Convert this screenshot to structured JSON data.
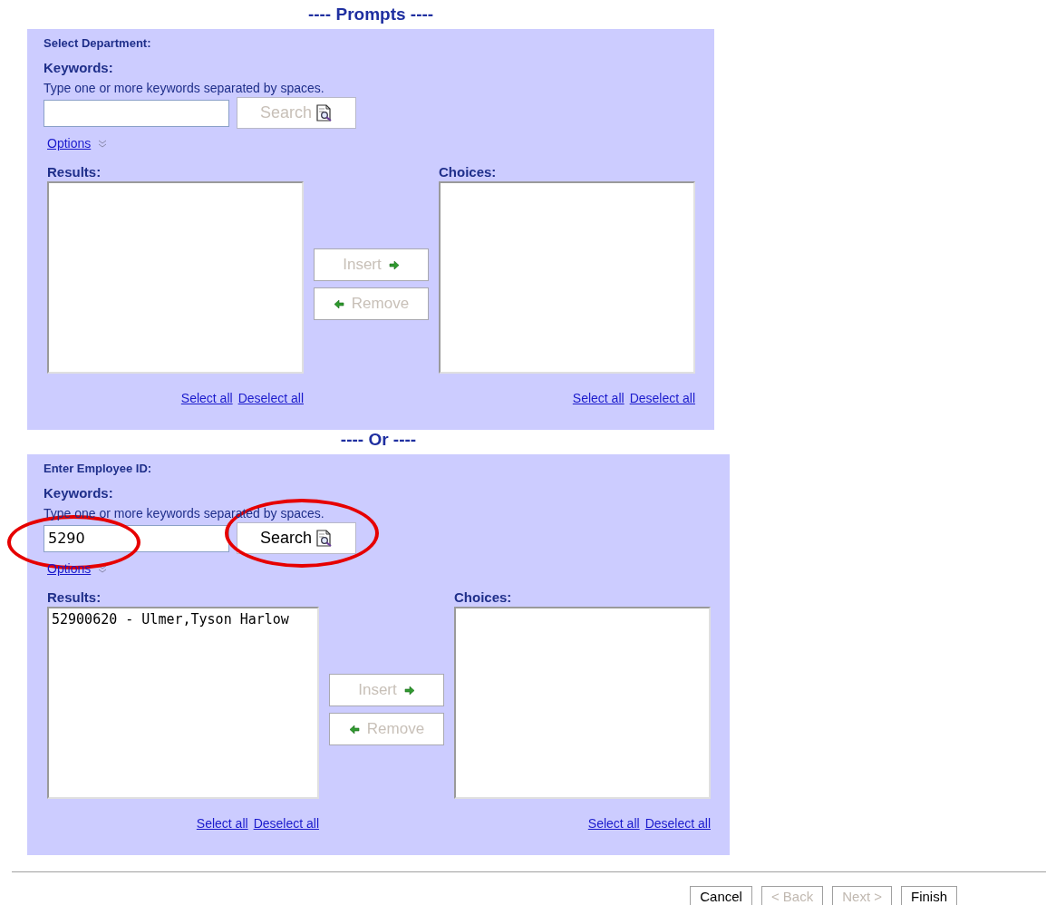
{
  "sections": [
    {
      "heading": "---- Prompts ----",
      "prompt": "Select Department:",
      "keywords_label": "Keywords:",
      "hint": "Type one or more keywords separated by spaces.",
      "field": {
        "circled": false
      },
      "search_button": {
        "label": "Search",
        "disabled": true,
        "circled": false
      },
      "options_link": "Options",
      "results": {
        "label": "Results:",
        "links": [
          "Select all",
          "Deselect all"
        ]
      },
      "insert_button": {
        "label": "Insert",
        "disabled": true
      },
      "remove_button": {
        "label": "Remove",
        "disabled": true
      },
      "choices": {
        "label": "Choices:",
        "links": [
          "Select all",
          "Deselect all"
        ]
      }
    },
    {
      "heading": "---- Or ----",
      "prompt": "Enter Employee ID:",
      "keywords_label": "Keywords:",
      "hint": "Type one or more keywords separated by spaces.",
      "field": {
        "value": "5290",
        "circled": true
      },
      "search_button": {
        "label": "Search",
        "disabled": false,
        "circled": true
      },
      "options_link": "Options",
      "results": {
        "label": "Results:",
        "items": [
          "52900620 - Ulmer,Tyson Harlow"
        ],
        "links": [
          "Select all",
          "Deselect all"
        ]
      },
      "insert_button": {
        "label": "Insert",
        "disabled": true
      },
      "remove_button": {
        "label": "Remove",
        "disabled": true
      },
      "choices": {
        "label": "Choices:",
        "links": [
          "Select all",
          "Deselect all"
        ]
      }
    }
  ],
  "footer_buttons": [
    {
      "label": "Cancel",
      "disabled": false
    },
    {
      "label": "< Back",
      "disabled": true
    },
    {
      "label": "Next >",
      "disabled": true
    },
    {
      "label": "Finish",
      "disabled": false
    }
  ]
}
